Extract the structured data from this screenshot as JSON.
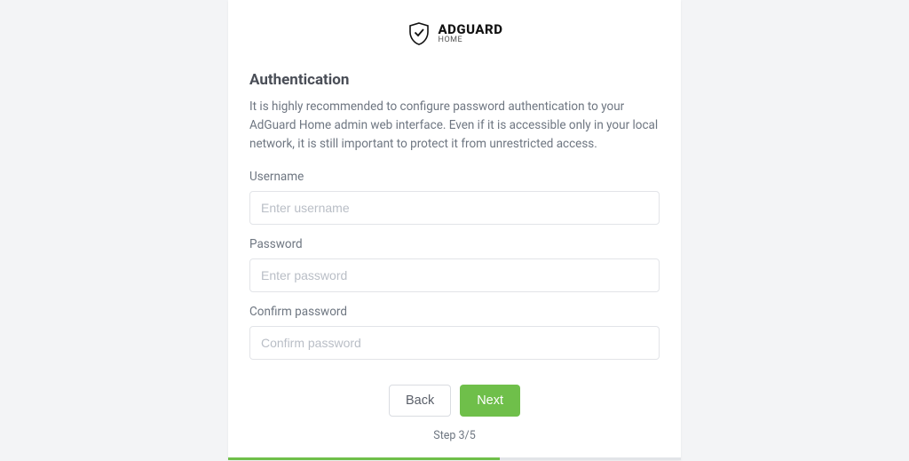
{
  "logo": {
    "brand": "ADGUARD",
    "sub": "HOME"
  },
  "heading": "Authentication",
  "description": "It is highly recommended to configure password authentication to your AdGuard Home admin web interface. Even if it is accessible only in your local network, it is still important to protect it from unrestricted access.",
  "form": {
    "username_label": "Username",
    "username_placeholder": "Enter username",
    "username_value": "",
    "password_label": "Password",
    "password_placeholder": "Enter password",
    "password_value": "",
    "confirm_label": "Confirm password",
    "confirm_placeholder": "Confirm password",
    "confirm_value": ""
  },
  "buttons": {
    "back": "Back",
    "next": "Next"
  },
  "step": "Step 3/5",
  "progress": {
    "current": 3,
    "total": 5
  }
}
